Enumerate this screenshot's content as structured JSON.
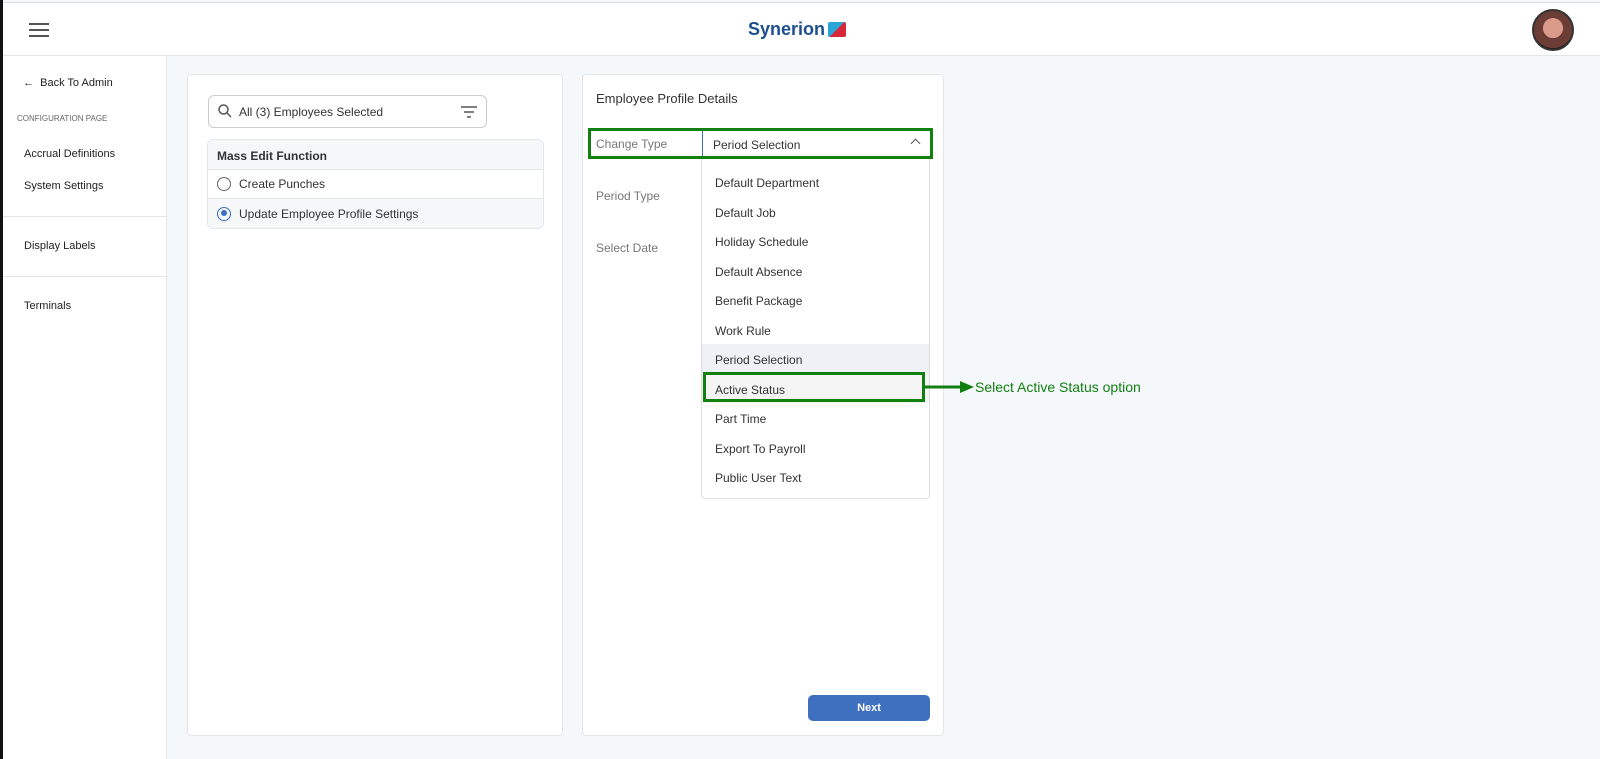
{
  "header": {
    "logo_text": "Synerion"
  },
  "sidebar": {
    "back": "Back To Admin",
    "section": "CONFIGURATION PAGE",
    "items": [
      "Accrual Definitions",
      "System Settings",
      "Display Labels",
      "Terminals"
    ]
  },
  "left": {
    "search_value": "All (3) Employees Selected",
    "mass_edit_title": "Mass Edit Function",
    "options": [
      {
        "label": "Create Punches",
        "selected": false
      },
      {
        "label": "Update Employee Profile Settings",
        "selected": true
      }
    ]
  },
  "right": {
    "title": "Employee Profile Details",
    "change_type_label": "Change Type",
    "change_type_value": "Period Selection",
    "period_type_label": "Period Type",
    "select_date_label": "Select Date",
    "next": "Next"
  },
  "dropdown": {
    "options": [
      "Default Department",
      "Default Job",
      "Holiday Schedule",
      "Default Absence",
      "Benefit Package",
      "Work Rule",
      "Period Selection",
      "Active Status",
      "Part Time",
      "Export To Payroll",
      "Public User Text"
    ],
    "selected": "Period Selection"
  },
  "annotation": {
    "text": "Select Active Status option",
    "color": "#118011"
  }
}
